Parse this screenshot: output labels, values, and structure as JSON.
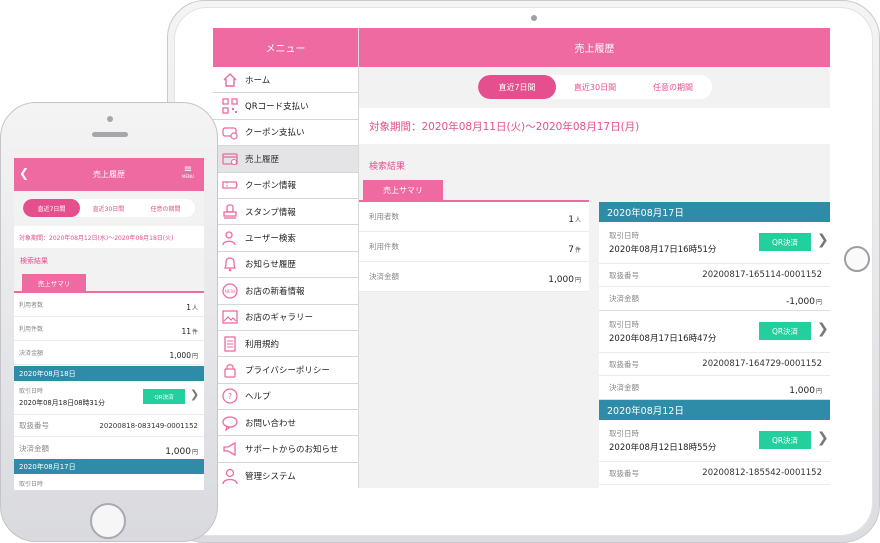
{
  "tablet": {
    "menu_title": "メニュー",
    "menu": [
      {
        "label": "ホーム",
        "icon": "home-icon"
      },
      {
        "label": "QRコード支払い",
        "icon": "qr-code-icon"
      },
      {
        "label": "クーポン支払い",
        "icon": "coupon-payment-icon"
      },
      {
        "label": "売上履歴",
        "icon": "sales-history-icon",
        "active": true
      },
      {
        "label": "クーポン情報",
        "icon": "coupon-icon"
      },
      {
        "label": "スタンプ情報",
        "icon": "stamp-icon"
      },
      {
        "label": "ユーザー検索",
        "icon": "user-search-icon"
      },
      {
        "label": "お知らせ履歴",
        "icon": "bell-icon"
      },
      {
        "label": "お店の新着情報",
        "icon": "new-badge-icon"
      },
      {
        "label": "お店のギャラリー",
        "icon": "gallery-icon"
      },
      {
        "label": "利用規約",
        "icon": "document-icon"
      },
      {
        "label": "プライバシーポリシー",
        "icon": "lock-icon"
      },
      {
        "label": "ヘルプ",
        "icon": "help-icon"
      },
      {
        "label": "お問い合わせ",
        "icon": "chat-icon"
      },
      {
        "label": "サポートからのお知らせ",
        "icon": "megaphone-icon"
      },
      {
        "label": "管理システム",
        "icon": "admin-user-icon"
      }
    ],
    "page_title": "売上履歴",
    "tabs": [
      "直近7日間",
      "直近30日間",
      "任意の期間"
    ],
    "period": "対象期間：2020年08月11日(火)〜2020年08月17日(月)",
    "search_results": "検索結果",
    "summary_tab": "売上サマリ",
    "summary": [
      {
        "label": "利用者数",
        "value": "1",
        "unit": "人"
      },
      {
        "label": "利用件数",
        "value": "7",
        "unit": "件"
      },
      {
        "label": "決済金額",
        "value": "1,000",
        "unit": "円"
      }
    ],
    "groups": [
      {
        "date": "2020年08月17日",
        "transactions": [
          {
            "datetime_label": "取引日時",
            "datetime": "2020年08月17日16時51分",
            "badge": "QR決済",
            "id_label": "取扱番号",
            "id": "20200817-165114-0001152",
            "amount_label": "決済金額",
            "amount": "-1,000",
            "unit": "円"
          },
          {
            "datetime_label": "取引日時",
            "datetime": "2020年08月17日16時47分",
            "badge": "QR決済",
            "id_label": "取扱番号",
            "id": "20200817-164729-0001152",
            "amount_label": "決済金額",
            "amount": "1,000",
            "unit": "円"
          }
        ]
      },
      {
        "date": "2020年08月12日",
        "transactions": [
          {
            "datetime_label": "取引日時",
            "datetime": "2020年08月12日18時55分",
            "badge": "QR決済",
            "id_label": "取扱番号",
            "id": "20200812-185542-0001152"
          }
        ]
      }
    ]
  },
  "phone": {
    "page_title": "売上履歴",
    "menu_label": "MENU",
    "tabs": [
      "直近7日間",
      "直近30日間",
      "任意の期間"
    ],
    "period": "対象期間：2020年08月12日(水)〜2020年08月18日(火)",
    "search_results": "検索結果",
    "summary_tab": "売上サマリ",
    "summary": [
      {
        "label": "利用者数",
        "value": "1",
        "unit": "人"
      },
      {
        "label": "利用件数",
        "value": "11",
        "unit": "件"
      },
      {
        "label": "決済金額",
        "value": "1,000",
        "unit": "円"
      }
    ],
    "groups": [
      {
        "date": "2020年08月18日",
        "transactions": [
          {
            "datetime_label": "取引日時",
            "datetime": "2020年08月18日08時31分",
            "badge": "QR決済",
            "id_label": "取扱番号",
            "id": "20200818-083149-0001152",
            "amount_label": "決済金額",
            "amount": "1,000",
            "unit": "円"
          }
        ]
      },
      {
        "date": "2020年08月17日",
        "transactions": [
          {
            "datetime_label": "取引日時"
          }
        ]
      }
    ]
  },
  "colors": {
    "pink": "#ee6aa0",
    "pink_dark": "#e54f8d",
    "teal": "#2f8ca9",
    "green": "#23cf9c"
  }
}
